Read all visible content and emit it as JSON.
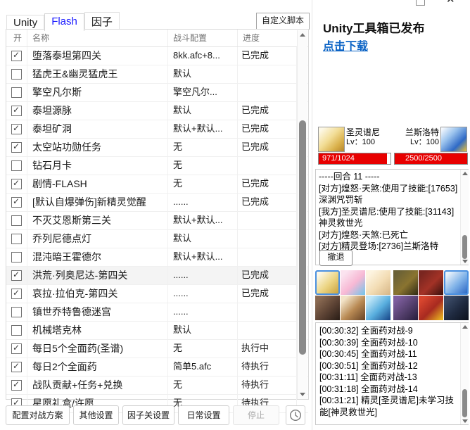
{
  "colors": {
    "tab_selected_blue": "#1a1aff",
    "link_blue": "#0b63c5",
    "hp_red": "#e80000",
    "tile_selected_border": "#4a90e0"
  },
  "tabs": [
    {
      "label": "Unity",
      "selected": false
    },
    {
      "label": "Flash",
      "selected": true
    },
    {
      "label": "因子",
      "selected": false
    }
  ],
  "custom_script_button_label": "自定义脚本",
  "task_table": {
    "headers": [
      "开",
      "名称",
      "战斗配置",
      "进度"
    ],
    "rows": [
      {
        "checked": true,
        "name": "堕落泰坦第四关",
        "config": "8kk.afc+8...",
        "progress": "已完成",
        "highlighted": false
      },
      {
        "checked": false,
        "name": "猛虎王&幽灵猛虎王",
        "config": "默认",
        "progress": "",
        "highlighted": false
      },
      {
        "checked": false,
        "name": "擎空凡尔斯",
        "config": "擎空凡尔...",
        "progress": "",
        "highlighted": false
      },
      {
        "checked": true,
        "name": "泰坦源脉",
        "config": "默认",
        "progress": "已完成",
        "highlighted": false
      },
      {
        "checked": true,
        "name": "泰坦矿洞",
        "config": "默认+默认...",
        "progress": "已完成",
        "highlighted": false
      },
      {
        "checked": true,
        "name": "太空站功勋任务",
        "config": "无",
        "progress": "已完成",
        "highlighted": false
      },
      {
        "checked": false,
        "name": "钻石月卡",
        "config": "无",
        "progress": "",
        "highlighted": false
      },
      {
        "checked": true,
        "name": "剧情-FLASH",
        "config": "无",
        "progress": "已完成",
        "highlighted": false
      },
      {
        "checked": true,
        "name": "[默认自爆弹伤]新精灵觉醒",
        "config": "......",
        "progress": "已完成",
        "highlighted": false
      },
      {
        "checked": false,
        "name": "不灭艾恩斯第三关",
        "config": "默认+默认...",
        "progress": "",
        "highlighted": false
      },
      {
        "checked": false,
        "name": "乔列尼德点灯",
        "config": "默认",
        "progress": "",
        "highlighted": false
      },
      {
        "checked": false,
        "name": "混沌暗王霍德尔",
        "config": "默认+默认...",
        "progress": "",
        "highlighted": false
      },
      {
        "checked": true,
        "name": "洪荒·列奥尼达-第四关",
        "config": "......",
        "progress": "已完成",
        "highlighted": true
      },
      {
        "checked": true,
        "name": "哀拉·拉伯克-第四关",
        "config": "......",
        "progress": "已完成",
        "highlighted": false
      },
      {
        "checked": false,
        "name": "镇世乔特鲁德迷宫",
        "config": "......",
        "progress": "",
        "highlighted": false
      },
      {
        "checked": false,
        "name": "机械塔克林",
        "config": "默认",
        "progress": "",
        "highlighted": false
      },
      {
        "checked": true,
        "name": "每日5个全面药(圣谱)",
        "config": "无",
        "progress": "执行中",
        "highlighted": false
      },
      {
        "checked": true,
        "name": "每日2个全面药",
        "config": "简单5.afc",
        "progress": "待执行",
        "highlighted": false
      },
      {
        "checked": true,
        "name": "战队贡献+任务+兑换",
        "config": "无",
        "progress": "待执行",
        "highlighted": false
      },
      {
        "checked": true,
        "name": "星愿礼盒/许愿",
        "config": "无",
        "progress": "待执行",
        "highlighted": false
      }
    ]
  },
  "footer_buttons": [
    {
      "label": "配置对战方案",
      "enabled": true
    },
    {
      "label": "其他设置",
      "enabled": true
    },
    {
      "label": "因子关设置",
      "enabled": true
    },
    {
      "label": "日常设置",
      "enabled": true
    },
    {
      "label": "停止",
      "enabled": false
    }
  ],
  "announcement": {
    "title": "Unity工具箱已发布",
    "link_label": "点击下载"
  },
  "battle": {
    "ally": {
      "name": "圣灵谱尼",
      "level": "Lv：100",
      "hp_text": "971/1024",
      "hp_percent": 94.8
    },
    "enemy": {
      "name": "兰斯洛特",
      "level": "Lv：100",
      "hp_text": "2500/2500",
      "hp_percent": 100
    },
    "log_lines": [
      "-----回合 11 -----",
      "[对方]煌怒·天煞:使用了技能:[17653]深渊咒罚斩",
      "[我方]圣灵谱尼:使用了技能:[31143]神灵救世光",
      "[对方]煌怒·天煞:已死亡",
      "[对方]精灵登场:[2736]兰斯洛特"
    ],
    "retreat_button_label": "撤退"
  },
  "teams": {
    "ally": {
      "selected_index": 0,
      "tile_colors": [
        [
          "#fdf8e8",
          "#ecd584",
          "#c9a23c"
        ],
        [
          "#fbe3ef",
          "#f7b8d4",
          "#7ec3e8"
        ],
        [
          "#fdf4e0",
          "#f3ddb5",
          "#d9b98a"
        ],
        [
          "#8a6a52",
          "#5d4334",
          "#2e2018"
        ],
        [
          "#f2e3c8",
          "#b98a54",
          "#6e4a2a"
        ],
        [
          "#bfe6f7",
          "#58aede",
          "#1d4e8f"
        ]
      ]
    },
    "enemy": {
      "selected_index": 2,
      "tile_colors": [
        [
          "#6b6136",
          "#8a7430",
          "#3a3318"
        ],
        [
          "#7a2620",
          "#a33226",
          "#431410"
        ],
        [
          "#eaf2fb",
          "#7fb2e8",
          "#2b67c4"
        ],
        [
          "#7e5e9e",
          "#55406e",
          "#2c2140"
        ],
        [
          "#d8452e",
          "#a82a20",
          "#e8b320"
        ],
        [
          "#3a4a66",
          "#1f2a40",
          "#0e1420"
        ]
      ]
    }
  },
  "run_log": {
    "lines": [
      "[00:30:32] 全面药对战-9",
      "[00:30:39] 全面药对战-10",
      "[00:30:45] 全面药对战-11",
      "[00:30:51] 全面药对战-12",
      "[00:31:11] 全面药对战-13",
      "[00:31:18] 全面药对战-14",
      "[00:31:21] 精灵[圣灵谱尼]未学习技能[神灵救世光]"
    ]
  }
}
